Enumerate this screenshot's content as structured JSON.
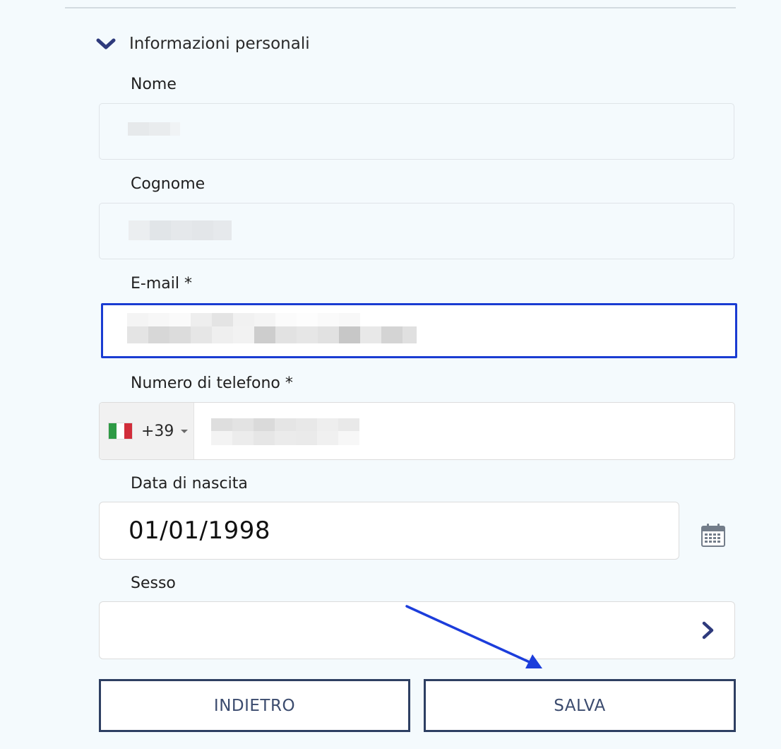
{
  "section": {
    "title": "Informazioni personali",
    "icon": "chevron-down-icon"
  },
  "fields": {
    "first_name": {
      "label": "Nome"
    },
    "last_name": {
      "label": "Cognome"
    },
    "email": {
      "label": "E-mail *"
    },
    "phone": {
      "label": "Numero di telefono *",
      "dial_code": "+39",
      "country_flag": "italy-flag-icon"
    },
    "birth_date": {
      "label": "Data di nascita",
      "value": "01/01/1998",
      "icon": "calendar-icon"
    },
    "gender": {
      "label": "Sesso",
      "icon": "chevron-right-icon"
    }
  },
  "buttons": {
    "back_label": "INDIETRO",
    "save_label": "SALVA"
  },
  "colors": {
    "accent": "#1a3cd2",
    "icon": "#2e3a7c",
    "button_border": "#2e3f62",
    "annotation": "#1c3ddb"
  }
}
